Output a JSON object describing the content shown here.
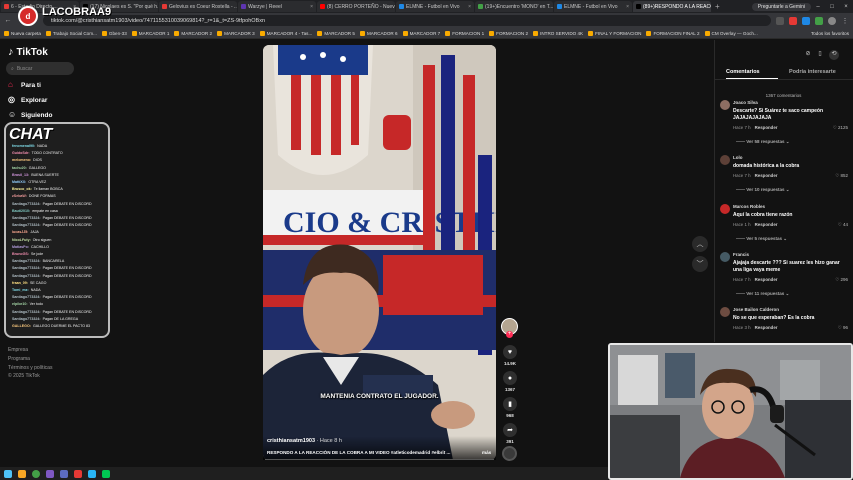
{
  "stream": {
    "name": "LACOBRAA9"
  },
  "browser": {
    "tabs": [
      {
        "label": "6 - Estadio Directo ...",
        "color": "#e53935",
        "active": false
      },
      {
        "label": "(17) Nicolaes es S. \"Por qué h...",
        "color": "#000000",
        "active": false
      },
      {
        "label": "Gelovius es Coeur Rostella - ...",
        "color": "#e53935",
        "active": false
      },
      {
        "label": "Warzye | Reeel",
        "color": "#5e35b1",
        "active": false
      },
      {
        "label": "(8) CERRO PORTEÑO - Nuevo...",
        "color": "#ff0000",
        "active": false
      },
      {
        "label": "ELMNE - Futbol en Vivo",
        "color": "#1e88e5",
        "active": false
      },
      {
        "label": "(19+)Encuentro 'MONO' en T...",
        "color": "#43a047",
        "active": false
      },
      {
        "label": "ELMNE - Futbol en Vivo",
        "color": "#1e88e5",
        "active": false
      },
      {
        "label": "(89+)RESPONDO A LA REACCI...",
        "color": "#000000",
        "active": true
      }
    ],
    "new_tab": "+",
    "gemini": "Preguntarle a Gemini",
    "url": "tiktok.com/@cristhiansatm1903/video/7471155310039069814?_r=1&_t=ZS-9tfpohOBxn",
    "bookmarks": [
      "Nueva carpeta",
      "Trabajo Social Com...",
      "Gben-33",
      "MARCADOR 1",
      "MARCADOR 2",
      "MARCADOR 3",
      "MARCADOR 4 - Tas...",
      "MARCADOR 5",
      "MARCADOR 6",
      "MARCADOR 7",
      "FORMACION 1",
      "FORMACION 2",
      "INTRO SERVIDO 4K",
      "FINAL Y FORMACION",
      "FORMACION FINAL 2",
      "CM Overlay — Goch..."
    ],
    "all_bookmarks": "Todos los favoritos"
  },
  "tiktok": {
    "logo": "TikTok",
    "search_placeholder": "Buscar",
    "nav": [
      {
        "label": "Para ti"
      },
      {
        "label": "Explorar"
      },
      {
        "label": "Siguiendo"
      }
    ],
    "footer": [
      "Empresa",
      "Programa",
      "Términos y políticas",
      "© 2025 TikTok"
    ]
  },
  "chat": {
    "title": "CHAT",
    "messages": [
      {
        "user": "fenomenal90:",
        "text": "NADA",
        "color": "#80deea"
      },
      {
        "user": "GuidoSdr:",
        "text": "TODO CONTRATO",
        "color": "#f48fb1"
      },
      {
        "user": "melomeno:",
        "text": "DIOS",
        "color": "#ffcc80"
      },
      {
        "user": "tachu20:",
        "text": "GALLEGO",
        "color": "#a5d6a7"
      },
      {
        "user": "Brasil_13:",
        "text": "BUENA SUERTE",
        "color": "#ce93d8"
      },
      {
        "user": "MattiXX:",
        "text": "OTRA VEZ",
        "color": "#90caf9"
      },
      {
        "user": "Brusco_ok:",
        "text": "Te llaman BOBCA",
        "color": "#fff59d"
      },
      {
        "user": "zSebaW:",
        "text": "DONE FORMAS",
        "color": "#ef9a9a"
      },
      {
        "user": "Santiago7T3324:",
        "text": "Pagan DEBATE EN DISCORD",
        "color": "#b0bec5"
      },
      {
        "user": "Bauti2010:",
        "text": "empate en casa",
        "color": "#80cbc4"
      },
      {
        "user": "Santiago7T3324:",
        "text": "Pagan DEBATE EN DISCORD",
        "color": "#b0bec5"
      },
      {
        "user": "Santiago7T3324:",
        "text": "Pagan DEBATE EN DISCORD",
        "color": "#b0bec5"
      },
      {
        "user": "lucasJJ5:",
        "text": "JAJA",
        "color": "#ffab91"
      },
      {
        "user": "NicoLFuty:",
        "text": "Otro siguen",
        "color": "#c5e1a5"
      },
      {
        "user": "MatiasPo:",
        "text": "CACHILLO",
        "color": "#b39ddb"
      },
      {
        "user": "BrunoGS:",
        "text": "Se jode",
        "color": "#f48fb1"
      },
      {
        "user": "Santiago7T3324:",
        "text": "BANCARELA",
        "color": "#b0bec5"
      },
      {
        "user": "Santiago7T3324:",
        "text": "Pagan DEBATE EN DISCORD",
        "color": "#b0bec5"
      },
      {
        "user": "Santiago7T3324:",
        "text": "Pagan DEBATE EN DISCORD",
        "color": "#b0bec5"
      },
      {
        "user": "fraan_09:",
        "text": "SE CAGO",
        "color": "#ffe082"
      },
      {
        "user": "Tomi_mx:",
        "text": "NADA",
        "color": "#80deea"
      },
      {
        "user": "Santiago7T3324:",
        "text": "Pagan DEBATE EN DISCORD",
        "color": "#b0bec5"
      },
      {
        "user": "elpibe10:",
        "text": "Ver todo",
        "color": "#a5d6a7"
      },
      {
        "user": "Santiago7T3324:",
        "text": "Pagan DEBATE EN DISCORD",
        "color": "#b0bec5"
      },
      {
        "user": "Santiago7T3324:",
        "text": "Pagan DE LA GREGA",
        "color": "#b0bec5"
      },
      {
        "user": "GALLEGO:",
        "text": "GALLEGO DUERME EL PACTO 83",
        "color": "#ffcc80"
      }
    ]
  },
  "video": {
    "subtitle": "MANTENIA CONTRATO EL JUGADOR.",
    "user": "cristhiansatm1903",
    "time": "· Hace 8 h",
    "description": "RESPONDO A LA REACCIÓN DE LA COBRA A MI VIDEO #atleticodemadrid #elbrit ...",
    "more": "más",
    "progress": 0.0,
    "actions": [
      {
        "icon": "heart-icon",
        "glyph": "♥",
        "count": "14.9K"
      },
      {
        "icon": "comment-icon",
        "glyph": "●",
        "count": "1367"
      },
      {
        "icon": "bookmark-icon",
        "glyph": "▮",
        "count": "968"
      },
      {
        "icon": "share-icon",
        "glyph": "➦",
        "count": "391"
      }
    ]
  },
  "comments": {
    "tab_comments": "Comentarios",
    "tab_interest": "Podría interesarte",
    "count": "1367 comentarios",
    "reply_label": "Responder",
    "items": [
      {
        "user": "Joaco Silva",
        "text": "Descarte? Si Suárez te saco campeón JAJAJAJAJAJA",
        "time": "Hace 7 h",
        "likes": "2125",
        "replies": "Ver 58 respuestas",
        "avatar": "#8d6e63"
      },
      {
        "user": "Lolo",
        "text": "domada histórica a la cobra",
        "time": "Hace 7 h",
        "likes": "852",
        "replies": "Ver 10 respuestas",
        "avatar": "#5d4037"
      },
      {
        "user": "Marcos Robles",
        "text": "Aquí la cobra tiene razón",
        "time": "Hace 1 h",
        "likes": "44",
        "replies": "Ver 5 respuestas",
        "avatar": "#c62828"
      },
      {
        "user": "Francis",
        "text": "Ajajaja descarte ??? Si suarez les hizo ganar una liga vaya meme",
        "time": "Hace 7 h",
        "likes": "296",
        "replies": "Ver 11 respuestas",
        "avatar": "#455a64"
      },
      {
        "user": "Jose Bailon Calderon",
        "text": "No se que esperaban? Es la cobra",
        "time": "Hace 3 h",
        "likes": "96",
        "replies": "",
        "avatar": "#6d4c41"
      }
    ]
  },
  "colors": {
    "accent": "#fe2c55",
    "background": "#121212"
  }
}
